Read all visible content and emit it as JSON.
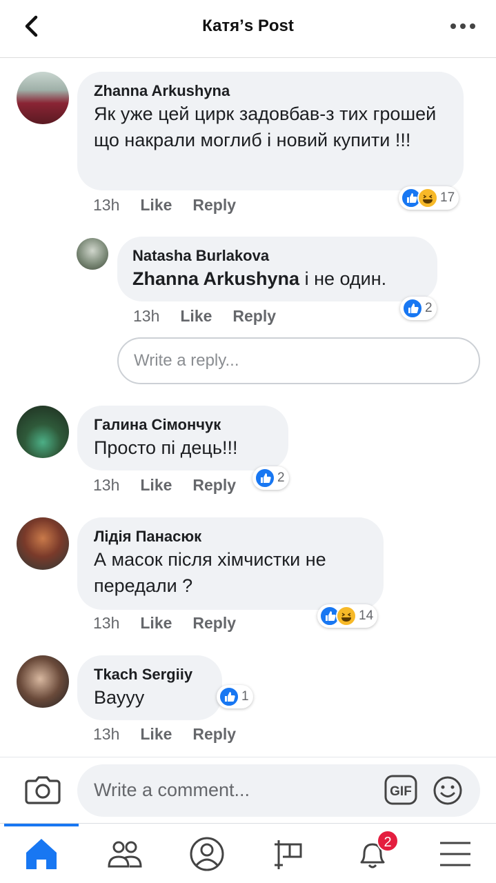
{
  "header": {
    "title": "Катя’s Post"
  },
  "comments": [
    {
      "author": "Zhanna Arkushyna",
      "text": "Як уже цей цирк задовбав-з тих грошей що накрали моглиб і новий купити !!!",
      "time": "13h",
      "like": "Like",
      "reply": "Reply",
      "reaction_count": "17",
      "reactions": [
        "like-icon",
        "haha-icon"
      ]
    },
    {
      "author": "Natasha  Burlakova",
      "mention": "Zhanna Arkushyna",
      "text": " і не один.",
      "time": "13h",
      "like": "Like",
      "reply": "Reply",
      "reaction_count": "2",
      "reactions": [
        "like-icon"
      ]
    },
    {
      "author": "Галина Сімончук",
      "text": "Просто пі дець!!!",
      "time": "13h",
      "like": "Like",
      "reply": "Reply",
      "reaction_count": "2",
      "reactions": [
        "like-icon"
      ]
    },
    {
      "author": "Лідія Панасюк",
      "text": "А масок після хімчистки не передали ?",
      "time": "13h",
      "like": "Like",
      "reply": "Reply",
      "reaction_count": "14",
      "reactions": [
        "like-icon",
        "haha-icon"
      ]
    },
    {
      "author": "Tkach Sergiiy",
      "text": "Вауyy",
      "time": "13h",
      "like": "Like",
      "reply": "Reply",
      "reaction_count": "1",
      "reactions": [
        "like-icon"
      ]
    }
  ],
  "reply_box": {
    "placeholder": "Write a reply..."
  },
  "composer": {
    "placeholder": "Write a comment...",
    "gif": "GIF"
  },
  "tabbar": {
    "notifications_badge": "2"
  },
  "colors": {
    "accent": "#1877f2",
    "bubble": "#f0f2f5",
    "badge": "#e41e3f"
  }
}
